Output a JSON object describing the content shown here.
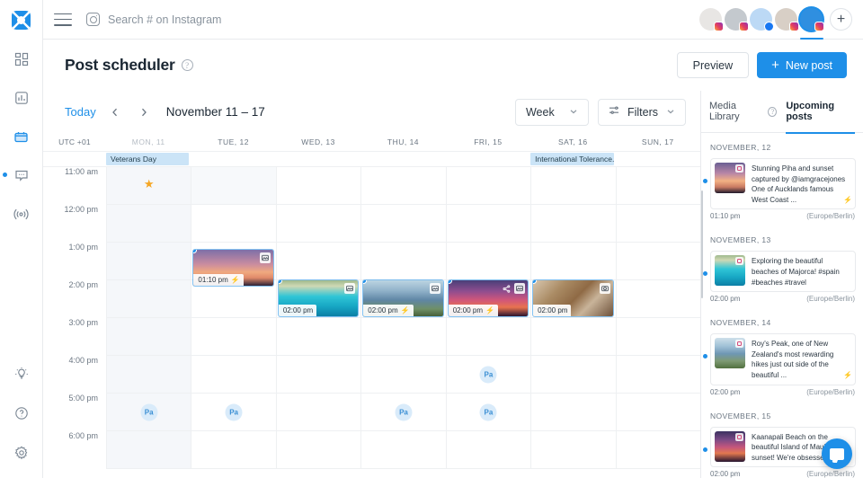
{
  "rail": {
    "logo_name": "app-logo",
    "items": [
      {
        "name": "dashboard",
        "icon": "grid-icon",
        "active": false
      },
      {
        "name": "analytics",
        "icon": "chart-icon",
        "active": false
      },
      {
        "name": "scheduler",
        "icon": "calendar-icon",
        "active": true
      },
      {
        "name": "inbox",
        "icon": "message-icon",
        "active": false,
        "dot": true
      },
      {
        "name": "listening",
        "icon": "broadcast-icon",
        "active": false
      }
    ],
    "bottom_items": [
      {
        "name": "ideas",
        "icon": "lightbulb-icon"
      },
      {
        "name": "help",
        "icon": "question-circle-icon"
      },
      {
        "name": "settings",
        "icon": "gear-icon"
      }
    ]
  },
  "topbar": {
    "menu_icon": "hamburger-icon",
    "search_icon": "instagram-icon",
    "search_placeholder": "Search # on Instagram",
    "search_value": "",
    "add_account_label": "+"
  },
  "header": {
    "title": "Post scheduler",
    "help_icon": "?",
    "preview_label": "Preview",
    "new_post_label": "New post",
    "new_post_plus": "+"
  },
  "toolbar": {
    "today_label": "Today",
    "prev_icon": "chevron-left-icon",
    "next_icon": "chevron-right-icon",
    "range_label": "November 11 – 17",
    "view_label": "Week",
    "filters_label": "Filters"
  },
  "calendar": {
    "timezone_label": "UTC +01",
    "days": [
      {
        "label": "MON, 11",
        "past": true
      },
      {
        "label": "TUE, 12",
        "past": false
      },
      {
        "label": "WED, 13",
        "past": false
      },
      {
        "label": "THU, 14",
        "past": false
      },
      {
        "label": "FRI, 15",
        "past": false
      },
      {
        "label": "SAT, 16",
        "past": false
      },
      {
        "label": "SUN, 17",
        "past": false
      }
    ],
    "holidays": [
      {
        "day": 0,
        "label": "Veterans Day"
      },
      {
        "day": 5,
        "label": "International Tolerance..."
      }
    ],
    "times": [
      "11:00 am",
      "12:00 pm",
      "1:00 pm",
      "2:00 pm",
      "3:00 pm",
      "4:00 pm",
      "5:00 pm",
      "6:00 pm"
    ],
    "events": [
      {
        "day": 1,
        "time_label": "01:10 pm",
        "slot": 2,
        "offset": 8,
        "image": "img-piha",
        "badge": "image-icon",
        "bolt": true,
        "share": false
      },
      {
        "day": 2,
        "time_label": "02:00 pm",
        "slot": 3,
        "offset": 0,
        "image": "img-majorca",
        "badge": "image-icon",
        "bolt": false,
        "share": false
      },
      {
        "day": 3,
        "time_label": "02:00 pm",
        "slot": 3,
        "offset": 0,
        "image": "img-mountain",
        "badge": "image-icon",
        "bolt": true,
        "share": false
      },
      {
        "day": 4,
        "time_label": "02:00 pm",
        "slot": 3,
        "offset": 0,
        "image": "img-palms",
        "badge": "image-icon",
        "bolt": true,
        "share": true
      },
      {
        "day": 5,
        "time_label": "02:00 pm",
        "slot": 3,
        "offset": 0,
        "image": "img-market",
        "badge": "camera-icon",
        "bolt": false,
        "share": false
      }
    ],
    "best_times": [
      {
        "day": 0,
        "slot": 6
      },
      {
        "day": 1,
        "slot": 6
      },
      {
        "day": 3,
        "slot": 6
      },
      {
        "day": 4,
        "slot": 5
      },
      {
        "day": 4,
        "slot": 6
      }
    ],
    "star": {
      "day": 0,
      "slot": 0,
      "glyph": "★"
    }
  },
  "panel": {
    "tab_media_label": "Media Library",
    "tab_media_help": "?",
    "tab_upcoming_label": "Upcoming posts",
    "groups": [
      {
        "date_label": "NOVEMBER, 12",
        "posts": [
          {
            "text": "Stunning Piha and sunset captured by @iamgracejones One of Aucklands famous West Coast ...",
            "time": "01:10 pm",
            "timezone": "(Europe/Berlin)",
            "image": "img-piha2",
            "bolt": true
          }
        ]
      },
      {
        "date_label": "NOVEMBER, 13",
        "posts": [
          {
            "text": "Exploring the beautiful beaches of Majorca! #spain #beaches #travel",
            "time": "02:00 pm",
            "timezone": "(Europe/Berlin)",
            "image": "img-majorca",
            "bolt": false
          }
        ]
      },
      {
        "date_label": "NOVEMBER, 14",
        "posts": [
          {
            "text": "Roy's Peak, one of New Zealand's most rewarding hikes just out side of the beautiful ...",
            "time": "02:00 pm",
            "timezone": "(Europe/Berlin)",
            "image": "img-roys",
            "bolt": true
          }
        ]
      },
      {
        "date_label": "NOVEMBER, 15",
        "posts": [
          {
            "text": "Kaanapali Beach on the beautiful Island of Maui at sunset! We're obsessed with ...",
            "time": "02:00 pm",
            "timezone": "(Europe/Berlin)",
            "image": "img-kaanap",
            "bolt": false
          }
        ]
      }
    ]
  },
  "chat": {
    "icon": "chat-bubble-icon"
  },
  "colors": {
    "accent": "#1e8fe8",
    "holiday": "#cbe4f7",
    "star": "#f5a623",
    "past": "#f5f7fa"
  }
}
